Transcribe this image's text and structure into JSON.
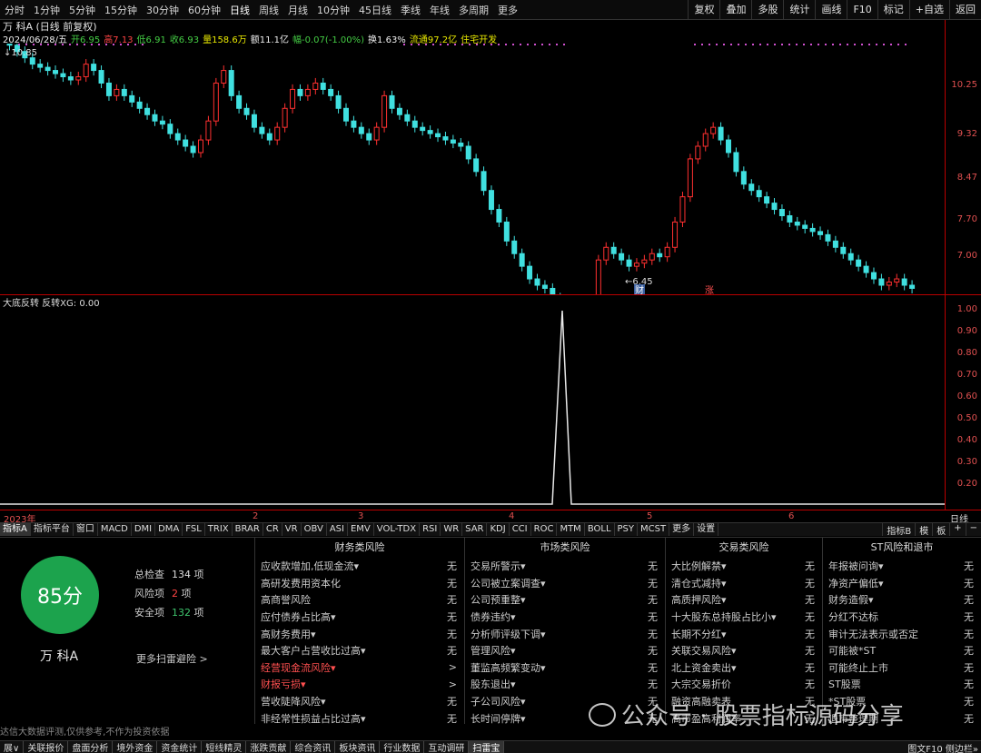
{
  "periods": [
    "分时",
    "1分钟",
    "5分钟",
    "15分钟",
    "30分钟",
    "60分钟",
    "日线",
    "周线",
    "月线",
    "10分钟",
    "45日线",
    "季线",
    "年线",
    "多周期",
    "更多"
  ],
  "period_active": "日线",
  "toolbar_right": [
    "复权",
    "叠加",
    "多股",
    "统计",
    "画线",
    "F10",
    "标记",
    "+自选",
    "返回"
  ],
  "info1": "万 科A (日线 前复权)",
  "info2": {
    "date": "2024/06/28/五",
    "open": "开6.95",
    "high": "高7.13",
    "low": "低6.91",
    "close": "收6.93",
    "volume": "量158.6万",
    "amount": "额11.1亿",
    "change": "幅-0.07(-1.00%)",
    "turnover": "换1.63%",
    "float": "流通97.2亿",
    "industry": "住宅开发"
  },
  "price_labels": {
    "max": "10.85",
    "min": "6.45",
    "fin": "财",
    "up": "涨"
  },
  "price_axis": [
    "10.25",
    "9.32",
    "8.47",
    "7.70",
    "7.00"
  ],
  "indicator_title": "大底反转  反转XG: 0.00",
  "indicator_axis": [
    "1.00",
    "0.90",
    "0.80",
    "0.70",
    "0.60",
    "0.50",
    "0.40",
    "0.30",
    "0.20"
  ],
  "time_labels": [
    "2023年",
    "2",
    "3",
    "4",
    "5",
    "6"
  ],
  "axis_right_label": "日线",
  "tabs": [
    "指标A",
    "指标平台",
    "窗口",
    "MACD",
    "DMI",
    "DMA",
    "FSL",
    "TRIX",
    "BRAR",
    "CR",
    "VR",
    "OBV",
    "ASI",
    "EMV",
    "VOL-TDX",
    "RSI",
    "WR",
    "SAR",
    "KDJ",
    "CCI",
    "ROC",
    "MTM",
    "BOLL",
    "PSY",
    "MCST",
    "更多",
    "设置"
  ],
  "tabs_right": [
    "指标B",
    "模",
    "板",
    "+",
    "−"
  ],
  "score": {
    "value": "85分",
    "name": "万 科A",
    "stats": [
      {
        "label": "总检查",
        "value": "134",
        "unit": "项",
        "color": "#ddd"
      },
      {
        "label": "风险项",
        "value": "2",
        "unit": "项",
        "color": "#ff4444"
      },
      {
        "label": "安全项",
        "value": "132",
        "unit": "项",
        "color": "#3ec46d"
      }
    ],
    "more": "更多扫雷避险 >",
    "disclaimer": "达信大数据评测,仅供参考,不作为投资依据"
  },
  "columns": [
    {
      "title": "财务类风险",
      "rows": [
        {
          "k": "应收款增加,低现金流▾",
          "v": "无"
        },
        {
          "k": "高研发费用资本化",
          "v": "无"
        },
        {
          "k": "高商誉风险",
          "v": "无"
        },
        {
          "k": "应付债券占比高▾",
          "v": "无"
        },
        {
          "k": "高财务费用▾",
          "v": "无"
        },
        {
          "k": "最大客户占营收比过高▾",
          "v": "无"
        },
        {
          "k": "经营现金流风险▾",
          "v": ">",
          "warn": true
        },
        {
          "k": "财报亏损▾",
          "v": ">",
          "warn": true
        },
        {
          "k": "营收陡降风险▾",
          "v": "无"
        },
        {
          "k": "非经常性损益占比过高▾",
          "v": "无"
        }
      ]
    },
    {
      "title": "市场类风险",
      "rows": [
        {
          "k": "交易所警示▾",
          "v": "无"
        },
        {
          "k": "公司被立案调查▾",
          "v": "无"
        },
        {
          "k": "公司预重整▾",
          "v": "无"
        },
        {
          "k": "债券违约▾",
          "v": "无"
        },
        {
          "k": "分析师评级下调▾",
          "v": "无"
        },
        {
          "k": "管理风险▾",
          "v": "无"
        },
        {
          "k": "董监高频繁变动▾",
          "v": "无"
        },
        {
          "k": "股东退出▾",
          "v": "无"
        },
        {
          "k": "子公司风险▾",
          "v": "无"
        },
        {
          "k": "长时间停牌▾",
          "v": "无"
        }
      ]
    },
    {
      "title": "交易类风险",
      "rows": [
        {
          "k": "大比例解禁▾",
          "v": "无"
        },
        {
          "k": "清仓式减持▾",
          "v": "无"
        },
        {
          "k": "高质押风险▾",
          "v": "无"
        },
        {
          "k": "十大股东总持股占比小▾",
          "v": "无"
        },
        {
          "k": "长期不分红▾",
          "v": "无"
        },
        {
          "k": "关联交易风险▾",
          "v": "无"
        },
        {
          "k": "北上资金卖出▾",
          "v": "无"
        },
        {
          "k": "大宗交易折价",
          "v": "无"
        },
        {
          "k": "融资高融卖表",
          "v": "无"
        },
        {
          "k": "高市盈高利润率",
          "v": "无"
        }
      ]
    },
    {
      "title": "ST风险和退市",
      "rows": [
        {
          "k": "年报被问询▾",
          "v": "无"
        },
        {
          "k": "净资产偏低▾",
          "v": "无"
        },
        {
          "k": "财务造假▾",
          "v": "无"
        },
        {
          "k": "分红不达标",
          "v": "无"
        },
        {
          "k": "审计无法表示或否定",
          "v": "无"
        },
        {
          "k": "可能被*ST",
          "v": "无"
        },
        {
          "k": "可能终止上市",
          "v": "无"
        },
        {
          "k": "ST股票",
          "v": "无"
        },
        {
          "k": "*ST股票",
          "v": "无"
        },
        {
          "k": "退市整理期",
          "v": "无"
        }
      ]
    }
  ],
  "watermark": "公众号 · 股票指标源码分享",
  "bottom_tabs": [
    "展∨",
    "关联报价",
    "盘面分析",
    "境外资金",
    "资金统计",
    "短线精灵",
    "涨跌贡献",
    "综合资讯",
    "板块资讯",
    "行业数据",
    "互动调研",
    "扫雷宝"
  ],
  "bottom_right": "图文F10 侧边栏»"
}
